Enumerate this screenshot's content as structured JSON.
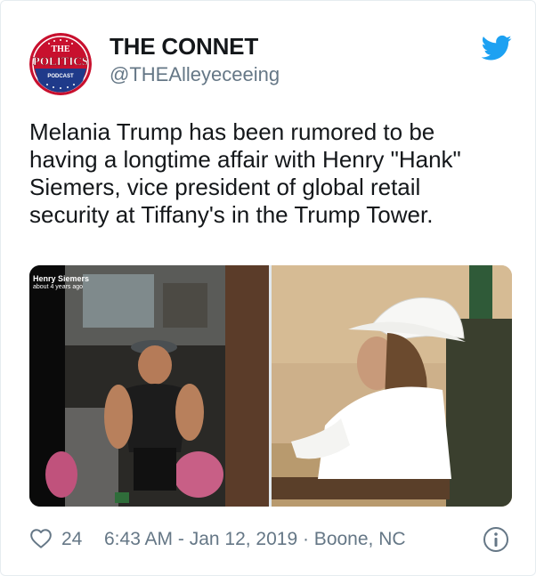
{
  "tweet": {
    "author": {
      "display_name": "THE CONNET",
      "handle": "@THEAlleyeceeing",
      "avatar_logo_lines": [
        "THE",
        "POLITICS",
        "PODCAST"
      ]
    },
    "text": "Melania Trump has been rumored to be\nhaving a longtime affair with Henry \"Hank\"\nSiemers,  vice president of global retail\nsecurity at Tiffany's in the Trump Tower.",
    "media": {
      "left_overlay_name": "Henry Siemers",
      "left_overlay_time": "about 4 years ago"
    },
    "footer": {
      "like_count": "24",
      "timestamp": "6:43 AM - Jan 12, 2019 · Boone, NC"
    }
  },
  "icons": {
    "brand": "twitter-bird-icon",
    "like": "heart-icon",
    "info": "info-icon"
  },
  "colors": {
    "twitter_blue": "#1da1f2",
    "muted_text": "#657786",
    "primary_text": "#14171a",
    "border": "#e6ecf0"
  }
}
